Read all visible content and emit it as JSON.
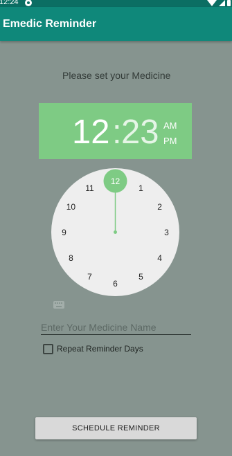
{
  "status_bar": {
    "time": "12:24",
    "icons": [
      "notification-icon",
      "wifi-icon",
      "signal-icon",
      "battery-icon"
    ]
  },
  "app_bar": {
    "title": "Emedic Reminder"
  },
  "prompt": "Please set your Medicine",
  "time_picker": {
    "hour": "12",
    "separator": ":",
    "minute": "23",
    "am_label": "AM",
    "pm_label": "PM",
    "selected_hour": 12,
    "dial_numbers": [
      "12",
      "1",
      "2",
      "3",
      "4",
      "5",
      "6",
      "7",
      "8",
      "9",
      "10",
      "11"
    ],
    "accent_color": "#7ecb84"
  },
  "keyboard_toggle": {
    "icon": "keyboard-icon"
  },
  "medicine_input": {
    "placeholder": "Enter Your Medicine Name",
    "value": ""
  },
  "repeat_checkbox": {
    "label": "Repeat Reminder Days",
    "checked": false
  },
  "schedule_button": {
    "label": "SCHEDULE REMINDER"
  }
}
